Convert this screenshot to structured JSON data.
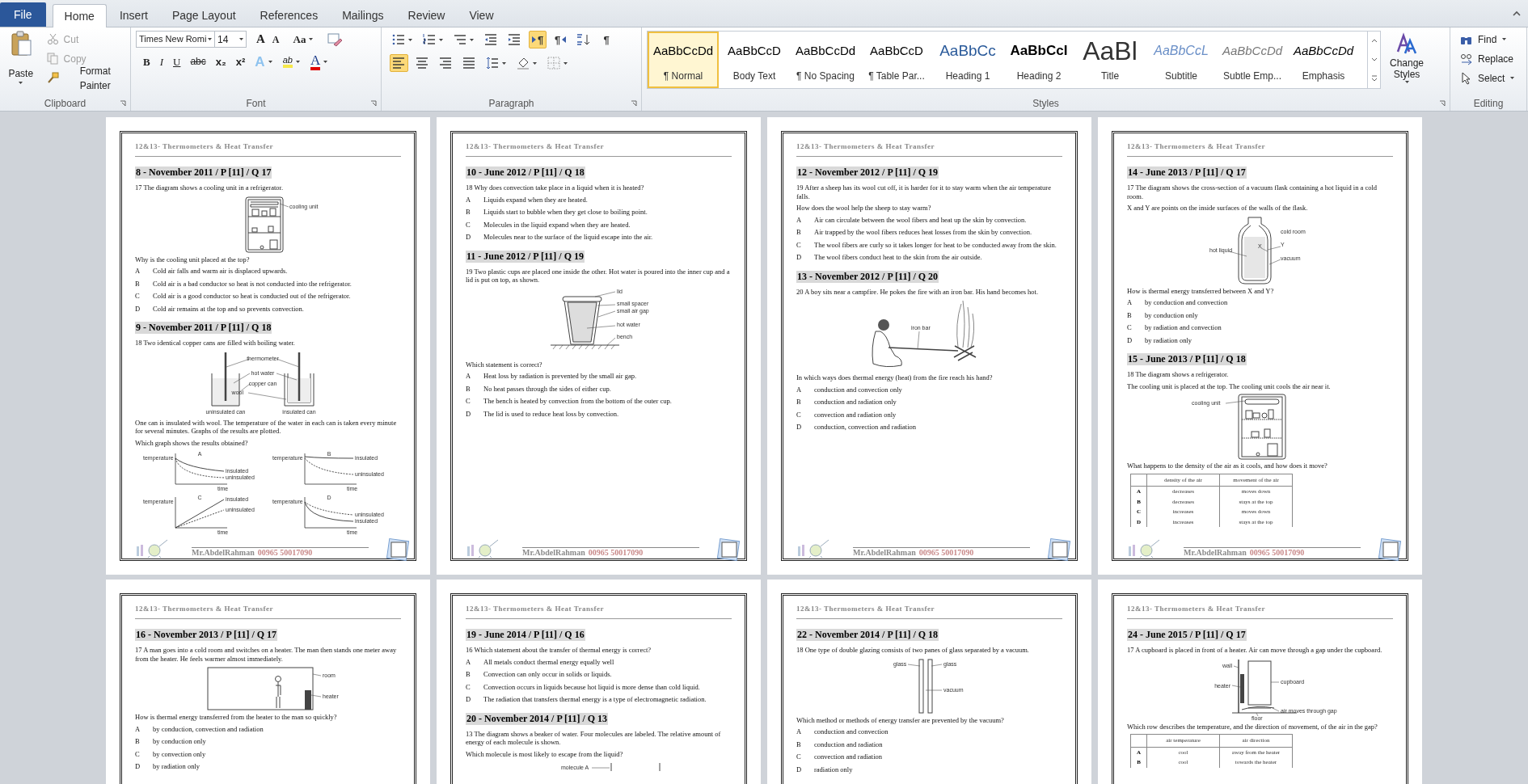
{
  "tabs": [
    {
      "label": "File",
      "kind": "file",
      "selected": false
    },
    {
      "label": "Home",
      "kind": "tab",
      "selected": true
    },
    {
      "label": "Insert",
      "kind": "tab",
      "selected": false
    },
    {
      "label": "Page Layout",
      "kind": "tab",
      "selected": false
    },
    {
      "label": "References",
      "kind": "tab",
      "selected": false
    },
    {
      "label": "Mailings",
      "kind": "tab",
      "selected": false
    },
    {
      "label": "Review",
      "kind": "tab",
      "selected": false
    },
    {
      "label": "View",
      "kind": "tab",
      "selected": false
    }
  ],
  "clipboard": {
    "group": "Clipboard",
    "paste": "Paste",
    "items": [
      {
        "label": "Cut",
        "kind": "cut",
        "disabled": true
      },
      {
        "label": "Copy",
        "kind": "copy",
        "disabled": true
      },
      {
        "label": "Format Painter",
        "kind": "painter",
        "disabled": false
      }
    ]
  },
  "font": {
    "group": "Font",
    "name": "Times New Romi",
    "size": "14",
    "tools": [
      {
        "kind": "grow",
        "glyph": "A"
      },
      {
        "kind": "shrink",
        "glyph": "A"
      },
      {
        "kind": "case",
        "glyph": "Aa"
      },
      {
        "kind": "clear"
      }
    ],
    "format": [
      {
        "kind": "bold",
        "glyph": "B"
      },
      {
        "kind": "italic",
        "glyph": "I"
      },
      {
        "kind": "underline",
        "glyph": "U"
      },
      {
        "kind": "strike",
        "glyph": "abc"
      },
      {
        "kind": "sub",
        "glyph": "x₂"
      },
      {
        "kind": "sup",
        "glyph": "x²"
      },
      {
        "kind": "effects",
        "glyph": "A"
      },
      {
        "kind": "highlight",
        "glyph": "ab"
      },
      {
        "kind": "color",
        "glyph": "A"
      }
    ]
  },
  "paragraph": {
    "group": "Paragraph",
    "row1": [
      {
        "kind": "bullets",
        "on": false
      },
      {
        "kind": "numbering",
        "on": false
      },
      {
        "kind": "multilevel",
        "on": false
      },
      {
        "kind": "outdent",
        "on": false
      },
      {
        "kind": "indent",
        "on": false
      },
      {
        "kind": "ltr",
        "glyph": "¶",
        "on": true
      },
      {
        "kind": "rtl",
        "glyph": "¶",
        "on": false
      },
      {
        "kind": "sort",
        "on": false
      },
      {
        "kind": "marks",
        "glyph": "¶",
        "on": false
      }
    ],
    "row2": [
      {
        "kind": "align_left",
        "on": true
      },
      {
        "kind": "center",
        "on": false
      },
      {
        "kind": "align_right",
        "on": false
      },
      {
        "kind": "justify",
        "on": false
      },
      {
        "kind": "spacing",
        "on": false
      },
      {
        "kind": "shading",
        "on": false
      },
      {
        "kind": "borders",
        "on": false
      }
    ]
  },
  "styles": {
    "group": "Styles",
    "change": "Change Styles",
    "items": [
      {
        "kind": "normal",
        "preview": "AaBbCcDd",
        "label": "¶ Normal",
        "selected": true
      },
      {
        "kind": "body",
        "preview": "AaBbCcD",
        "label": "Body Text",
        "selected": false
      },
      {
        "kind": "nospacing",
        "preview": "AaBbCcDd",
        "label": "¶ No Spacing",
        "selected": false
      },
      {
        "kind": "table",
        "preview": "AaBbCcD",
        "label": "¶ Table Par...",
        "selected": false
      },
      {
        "kind": "heading1",
        "preview": "AaBbCc",
        "label": "Heading 1",
        "selected": false
      },
      {
        "kind": "heading2",
        "preview": "AaBbCcI",
        "label": "Heading 2",
        "selected": false
      },
      {
        "kind": "title",
        "preview": "AaBl",
        "label": "Title",
        "selected": false
      },
      {
        "kind": "subtitle",
        "preview": "AaBbCcL",
        "label": "Subtitle",
        "selected": false
      },
      {
        "kind": "subtle",
        "preview": "AaBbCcDd",
        "label": "Subtle Emp...",
        "selected": false
      },
      {
        "kind": "emphasis",
        "preview": "AaBbCcDd",
        "label": "Emphasis",
        "selected": false
      }
    ]
  },
  "editing": {
    "group": "Editing",
    "items": [
      {
        "kind": "find",
        "label": "Find"
      },
      {
        "kind": "replace",
        "label": "Replace"
      },
      {
        "kind": "select",
        "label": "Select"
      }
    ]
  },
  "pages": [
    {
      "header": "12&13- Thermometers & Heat Transfer",
      "footer_name": "Mr.AbdelRahman",
      "footer_phone": "00965 50017090",
      "blocks": [
        {
          "kind": "heading",
          "text": "8 - November 2011 / P [11] / Q 17"
        },
        {
          "kind": "para",
          "text": "17 The diagram shows a cooling unit in a refrigerator."
        },
        {
          "kind": "fridge_side",
          "labels": [
            "cooling unit"
          ]
        },
        {
          "kind": "para",
          "text": "Why is the cooling unit placed at the top?"
        },
        {
          "kind": "option",
          "letter": "A",
          "text": "Cold air falls and warm air is displaced upwards."
        },
        {
          "kind": "option",
          "letter": "B",
          "text": "Cold air is a bad conductor so heat is not conducted into the refrigerator."
        },
        {
          "kind": "option",
          "letter": "C",
          "text": "Cold air is a good conductor so heat is conducted out of the refrigerator."
        },
        {
          "kind": "option",
          "letter": "D",
          "text": "Cold air remains at the top and so prevents convection."
        },
        {
          "kind": "heading",
          "text": "9 - November 2011 / P [11] / Q 18"
        },
        {
          "kind": "para",
          "text": "18 Two identical copper cans are filled with boiling water."
        },
        {
          "kind": "cans",
          "labels": [
            "thermometer",
            "hot water",
            "copper can",
            "wool",
            "uninsulated can",
            "insulated can"
          ]
        },
        {
          "kind": "para",
          "text": "One can is insulated with wool. The temperature of the water in each can is taken every minute for several minutes. Graphs of the results are plotted."
        },
        {
          "kind": "para",
          "text": "Which graph shows the results obtained?"
        },
        {
          "kind": "graphs",
          "panels": [
            {
              "title": "A",
              "ylabel": "temperature",
              "xlabel": "time",
              "curves": [
                {
                  "label": "insulated",
                  "kind": "slow_fall",
                  "dashed": false
                },
                {
                  "label": "uninsulated",
                  "kind": "fast_fall",
                  "dashed": true
                }
              ]
            },
            {
              "title": "B",
              "ylabel": "temperature",
              "xlabel": "time",
              "curves": [
                {
                  "label": "insulated",
                  "kind": "flat",
                  "dashed": false
                },
                {
                  "label": "uninsulated",
                  "kind": "mid_fall",
                  "dashed": true
                }
              ]
            },
            {
              "title": "C",
              "ylabel": "temperature",
              "xlabel": "time",
              "curves": [
                {
                  "label": "insulated",
                  "kind": "rise_steep",
                  "dashed": false
                },
                {
                  "label": "uninsulated",
                  "kind": "rise",
                  "dashed": true
                }
              ]
            },
            {
              "title": "D",
              "ylabel": "temperature",
              "xlabel": "time",
              "curves": [
                {
                  "label": "uninsulated",
                  "kind": "slow_fall",
                  "dashed": true
                },
                {
                  "label": "insulated",
                  "kind": "fast_fall",
                  "dashed": false
                }
              ]
            }
          ]
        }
      ]
    },
    {
      "header": "12&13- Thermometers & Heat Transfer",
      "footer_name": "Mr.AbdelRahman",
      "footer_phone": "00965 50017090",
      "blocks": [
        {
          "kind": "heading",
          "text": "10 - June 2012 / P [11] / Q 18"
        },
        {
          "kind": "para",
          "text": "18 Why does convection take place in a liquid when it is heated?"
        },
        {
          "kind": "option",
          "letter": "A",
          "text": "Liquids expand when they are heated."
        },
        {
          "kind": "option",
          "letter": "B",
          "text": "Liquids start to bubble when they get close to boiling point."
        },
        {
          "kind": "option",
          "letter": "C",
          "text": "Molecules in the liquid expand when they are heated."
        },
        {
          "kind": "option",
          "letter": "D",
          "text": "Molecules near to the surface of the liquid escape into the air."
        },
        {
          "kind": "heading",
          "text": "11 - June 2012 / P [11] / Q 19"
        },
        {
          "kind": "para",
          "text": "19 Two plastic cups are placed one inside the other. Hot water is poured into the inner cup and a lid is put on top, as shown."
        },
        {
          "kind": "cups",
          "labels": [
            "lid",
            "small spacer",
            "small air gap",
            "hot water",
            "bench"
          ]
        },
        {
          "kind": "para",
          "text": "Which statement is correct?"
        },
        {
          "kind": "option",
          "letter": "A",
          "text": "Heat loss by radiation is prevented by the small air gap."
        },
        {
          "kind": "option",
          "letter": "B",
          "text": "No heat passes through the sides of either cup."
        },
        {
          "kind": "option",
          "letter": "C",
          "text": "The bench is heated by convection from the bottom of the outer cup."
        },
        {
          "kind": "option",
          "letter": "D",
          "text": "The lid is used to reduce heat loss by convection."
        }
      ]
    },
    {
      "header": "12&13- Thermometers & Heat Transfer",
      "footer_name": "Mr.AbdelRahman",
      "footer_phone": "00965 50017090",
      "blocks": [
        {
          "kind": "heading",
          "text": "12 - November 2012 / P [11] / Q 19"
        },
        {
          "kind": "para",
          "text": "19 After a sheep has its wool cut off, it is harder for it to stay warm when the air temperature falls."
        },
        {
          "kind": "para",
          "text": "How does the wool help the sheep to stay warm?"
        },
        {
          "kind": "option",
          "letter": "A",
          "text": "Air can circulate between the wool fibers and heat up the skin by convection."
        },
        {
          "kind": "option",
          "letter": "B",
          "text": "Air trapped by the wool fibers reduces heat losses from the skin by convection."
        },
        {
          "kind": "option",
          "letter": "C",
          "text": "The wool fibers are curly so it takes longer for heat to be conducted away from the skin."
        },
        {
          "kind": "option",
          "letter": "D",
          "text": "The wool fibers conduct heat to the skin from the air outside."
        },
        {
          "kind": "heading",
          "text": "13 - November 2012 / P [11] / Q 20"
        },
        {
          "kind": "para",
          "text": "20 A boy sits near a campfire. He pokes the fire with an iron bar. His hand becomes hot."
        },
        {
          "kind": "campfire",
          "labels": [
            "iron bar"
          ]
        },
        {
          "kind": "para",
          "text": "In which ways does thermal energy (heat) from the fire reach his hand?"
        },
        {
          "kind": "option",
          "letter": "A",
          "text": "conduction and convection only"
        },
        {
          "kind": "option",
          "letter": "B",
          "text": "conduction and radiation only"
        },
        {
          "kind": "option",
          "letter": "C",
          "text": "convection and radiation only"
        },
        {
          "kind": "option",
          "letter": "D",
          "text": "conduction, convection and radiation"
        }
      ]
    },
    {
      "header": "12&13- Thermometers & Heat Transfer",
      "footer_name": "Mr.AbdelRahman",
      "footer_phone": "00965 50017090",
      "blocks": [
        {
          "kind": "heading",
          "text": "14 - June 2013 / P [11] / Q 17"
        },
        {
          "kind": "para",
          "text": "17 The diagram shows the cross-section of a vacuum flask containing a hot liquid in a cold room."
        },
        {
          "kind": "para",
          "text": "X and Y are points on the inside surfaces of the walls of the flask."
        },
        {
          "kind": "flask",
          "labels": [
            "cold room",
            "X",
            "Y",
            "hot liquid",
            "vacuum"
          ]
        },
        {
          "kind": "para",
          "text": "How is thermal energy transferred between X and Y?"
        },
        {
          "kind": "option",
          "letter": "A",
          "text": "by conduction and convection"
        },
        {
          "kind": "option",
          "letter": "B",
          "text": "by conduction only"
        },
        {
          "kind": "option",
          "letter": "C",
          "text": "by radiation and convection"
        },
        {
          "kind": "option",
          "letter": "D",
          "text": "by radiation only"
        },
        {
          "kind": "heading",
          "text": "15 - June 2013 / P [11] / Q 18"
        },
        {
          "kind": "para",
          "text": "18 The diagram shows a refrigerator."
        },
        {
          "kind": "para",
          "text": "The cooling unit is placed at the top. The cooling unit cools the air near it."
        },
        {
          "kind": "fridge_front",
          "labels": [
            "cooling unit"
          ]
        },
        {
          "kind": "para",
          "text": "What happens to the density of the air as it cools, and how does it move?"
        },
        {
          "kind": "table",
          "columns": [
            "density of the air",
            "movement of the air"
          ],
          "rows": [
            {
              "letter": "A",
              "cells": [
                "decreases",
                "moves down"
              ]
            },
            {
              "letter": "B",
              "cells": [
                "decreases",
                "stays at the top"
              ]
            },
            {
              "letter": "C",
              "cells": [
                "increases",
                "moves down"
              ]
            },
            {
              "letter": "D",
              "cells": [
                "increases",
                "stays at the top"
              ]
            }
          ]
        }
      ]
    },
    {
      "header": "12&13- Thermometers & Heat Transfer",
      "blocks": [
        {
          "kind": "heading",
          "text": "16 - November 2013 / P [11] / Q 17"
        },
        {
          "kind": "para",
          "text": "17 A man goes into a cold room and switches on a heater. The man then stands one meter away from the heater. He feels warmer almost immediately."
        },
        {
          "kind": "room",
          "labels": [
            "room",
            "heater"
          ]
        },
        {
          "kind": "para",
          "text": "How is thermal energy transferred from the heater to the man so quickly?"
        },
        {
          "kind": "option",
          "letter": "A",
          "text": "by conduction, convection and radiation"
        },
        {
          "kind": "option",
          "letter": "B",
          "text": "by conduction only"
        },
        {
          "kind": "option",
          "letter": "C",
          "text": "by convection only"
        },
        {
          "kind": "option",
          "letter": "D",
          "text": "by radiation only"
        }
      ]
    },
    {
      "header": "12&13- Thermometers & Heat Transfer",
      "blocks": [
        {
          "kind": "heading",
          "text": "19 - June 2014 / P [11] / Q 16"
        },
        {
          "kind": "para",
          "text": "16 Which statement about the transfer of thermal energy is correct?"
        },
        {
          "kind": "option",
          "letter": "A",
          "text": "All metals conduct thermal energy equally well"
        },
        {
          "kind": "option",
          "letter": "B",
          "text": "Convection can only occur in solids or liquids."
        },
        {
          "kind": "option",
          "letter": "C",
          "text": "Convection occurs in liquids because hot liquid is more dense than cold liquid."
        },
        {
          "kind": "option",
          "letter": "D",
          "text": "The radiation that transfers thermal energy is a type of electromagnetic radiation."
        },
        {
          "kind": "heading",
          "text": "20 - November 2014 / P [11] / Q 13"
        },
        {
          "kind": "para",
          "text": "13 The diagram shows a beaker of water. Four molecules are labeled. The relative amount of energy of each molecule is shown."
        },
        {
          "kind": "para",
          "text": "Which molecule is most likely to escape from the liquid?"
        },
        {
          "kind": "beaker",
          "labels": [
            "molecule A"
          ]
        }
      ]
    },
    {
      "header": "12&13- Thermometers & Heat Transfer",
      "blocks": [
        {
          "kind": "heading",
          "text": "22 - November 2014 / P [11] / Q 18"
        },
        {
          "kind": "para",
          "text": "18 One type of double glazing consists of two panes of glass separated by a vacuum."
        },
        {
          "kind": "glazing",
          "labels": [
            "glass",
            "glass",
            "vacuum"
          ]
        },
        {
          "kind": "para",
          "text": "Which method or methods of energy transfer are prevented by the vacuum?"
        },
        {
          "kind": "option",
          "letter": "A",
          "text": "conduction and convection"
        },
        {
          "kind": "option",
          "letter": "B",
          "text": "conduction and radiation"
        },
        {
          "kind": "option",
          "letter": "C",
          "text": "convection and radiation"
        },
        {
          "kind": "option",
          "letter": "D",
          "text": "radiation only"
        }
      ]
    },
    {
      "header": "12&13- Thermometers & Heat Transfer",
      "blocks": [
        {
          "kind": "heading",
          "text": "24 - June 2015 / P [11] / Q 17"
        },
        {
          "kind": "para",
          "text": "17 A cupboard is placed in front of a heater. Air can move through a gap under the cupboard."
        },
        {
          "kind": "cupboard",
          "labels": [
            "wall",
            "heater",
            "cupboard",
            "air moves through gap",
            "floor"
          ]
        },
        {
          "kind": "para",
          "text": "Which row describes the temperature, and the direction of movement, of the air in the gap?"
        },
        {
          "kind": "table",
          "columns": [
            "air temperature",
            "air direction"
          ],
          "rows": [
            {
              "letter": "A",
              "cells": [
                "cool",
                "away from the heater"
              ]
            },
            {
              "letter": "B",
              "cells": [
                "cool",
                "towards the heater"
              ]
            }
          ]
        }
      ]
    }
  ]
}
